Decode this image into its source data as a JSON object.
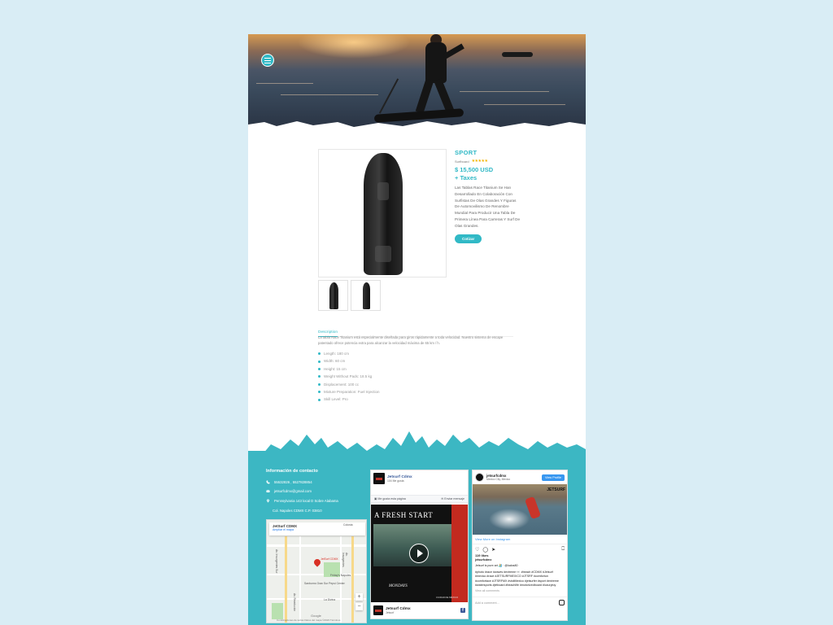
{
  "hero": {
    "menu_icon": "hamburger-icon"
  },
  "product": {
    "title": "SPORT",
    "category": "Surfboard",
    "rating": "★★★★★",
    "price": "$ 15,500 USD",
    "price_suffix": "+ Taxes",
    "description": "Las Tablas Race Titanium Se Han Desarrollado En Colaboración Con Surfistas De Olas Grandes Y Figuras De Automovilismo De Renombre Mundial Para Producir Una Tabla De Primera Línea Para Carreras Y Surf De Olas Grandes.",
    "cta_label": "Cotizar",
    "accent_color": "#31b9c6"
  },
  "tabs": {
    "description_label": "Description",
    "body": "La tabla Race Titanium está especialmente diseñada para giros rápidamente a toda velocidad. Nuestro sistema de escape patentado ofrece potencia extra para alcanzar la velocidad máxima de 65 km / h.",
    "specs": [
      "Length: 180 cm",
      "Width: 60 cm",
      "Height: 15 cm",
      "Weight Without Pads: 18.5 kg",
      "Displacement: 100 cc",
      "Mixture Preparation: Fuel Injection",
      "Skill Level: Pro"
    ]
  },
  "footer": {
    "contact_title": "Información de contacto",
    "phone": "55532826 , 5527828854",
    "email": "jetsurfcdmx@gmail.com",
    "address_1": "Pennsylvania 143 local D Sobre Alabama",
    "address_2": "Col. Napoles CDMX C.P. 03810",
    "map": {
      "place": "JetSurf CDMX",
      "enlarge": "Ampliar el mapa",
      "pin_label": "JetSurf CDMX",
      "streets": [
        "Colonia",
        "Av. Insurgentes Sur",
        "Av. Insurgentes",
        "Av. Revolución"
      ],
      "labels": [
        "Friday's Nápoles",
        "Sanborns Gran Sur Pepsi Center",
        "La Divina"
      ],
      "google": "Google",
      "terms": "Combinaciones de teclas   Datos del mapa ©2023   Términos"
    },
    "facebook": {
      "page_name": "Jetsurf Cdmx",
      "likes": "104 Me gusta",
      "like_btn": "Me gusta esta página",
      "send_btn": "Enviar mensaje",
      "video_headline": "A FRESH START",
      "video_sub": "MONDAYS",
      "video_city": "CIUDAD DE MÉXICO",
      "footer_name": "Jetsurf Cdmx",
      "footer_sub": "Jetsurf"
    },
    "instagram": {
      "username": "jetsurfcdmx",
      "location": "Mexico City, Mexico",
      "view_profile": "View Profile",
      "photo_tag": "JETSURF",
      "view_more": "View More on Instagram",
      "likes": "119 likes",
      "user": "jetsurfcdmx",
      "caption": "Jetsurf is pure art 🏄 · @kalos80",
      "hashtags": "#photo #race #waves #extreme 👀 #beach #CDMX #Jetsurf #mexico #race #JETSURFMEXICO #JTSRF #comfortun #comfortace #JTSRFMX #visitMexico #jetsurfer #sport #extreme #watersports #jetboard #beachlife #motorizedboard #luxurytoy",
      "view_all": "View all comments",
      "add_comment": "Add a comment..."
    }
  }
}
